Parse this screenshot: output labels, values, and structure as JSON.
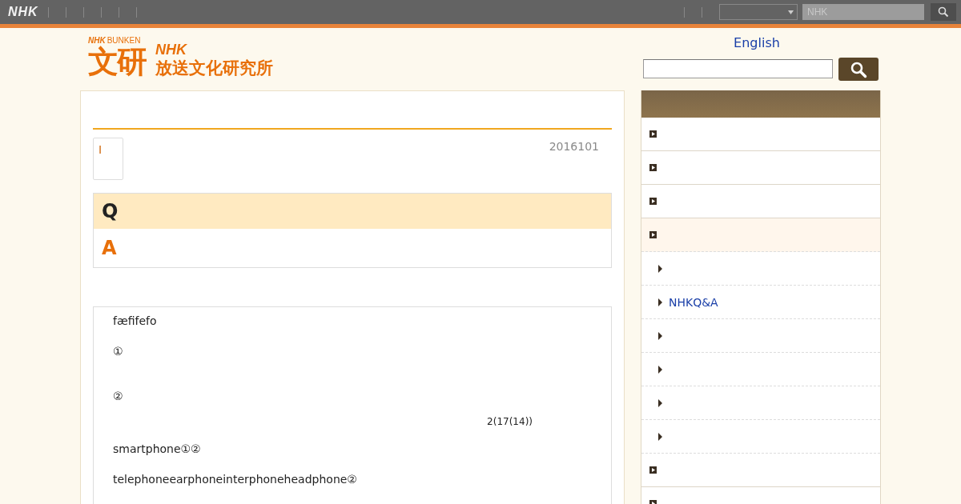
{
  "top_bar": {
    "logo": "NHK",
    "search": {
      "placeholder": "NHK"
    }
  },
  "header": {
    "logo": {
      "small": "NHK",
      "small_suffix": "BUNKEN",
      "mark": "文研",
      "brand": "NHK",
      "name": "放送文化研究所"
    },
    "language_link": "English"
  },
  "article": {
    "badge": "I",
    "date": "2016101",
    "question_label": "Q",
    "answer_label": "A",
    "paragraphs": [
      {
        "kind": "text",
        "text": "fæfifefo"
      },
      {
        "kind": "text",
        "text": "①"
      },
      {
        "kind": "gap"
      },
      {
        "kind": "text",
        "text": "②"
      },
      {
        "kind": "note",
        "text": "2(17(14))"
      },
      {
        "kind": "text",
        "text": "smartphone①②"
      },
      {
        "kind": "text",
        "text": "telephoneearphoneinterphoneheadphone②"
      }
    ]
  },
  "sidebar": {
    "items": [
      {
        "expanded": false
      },
      {
        "expanded": false
      },
      {
        "expanded": false
      },
      {
        "expanded": true,
        "children": [
          {
            "kind": "blank"
          },
          {
            "kind": "link",
            "label": "NHKQ&A"
          },
          {
            "kind": "blank"
          },
          {
            "kind": "blank"
          },
          {
            "kind": "blank"
          },
          {
            "kind": "blank"
          }
        ]
      },
      {
        "expanded": false
      },
      {
        "expanded": false
      }
    ]
  }
}
